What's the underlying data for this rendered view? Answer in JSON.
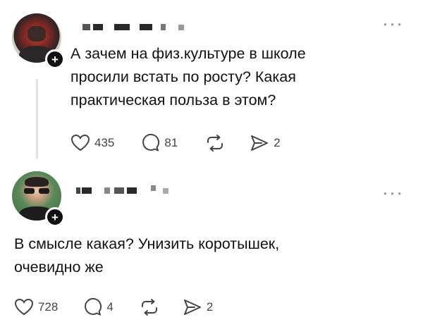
{
  "posts": [
    {
      "username": "",
      "text": "А зачем на физ.культуре в школе просили встать по росту? Какая практическая польза в этом?",
      "likes": "435",
      "comments": "81",
      "shares": "2"
    },
    {
      "username": "",
      "text": "В смысле какая? Унизить коротышек, очевидно же",
      "likes": "728",
      "comments": "4",
      "shares": "2"
    }
  ],
  "icons": {
    "more": "more-horizontal-icon",
    "like": "heart-icon",
    "comment": "comment-bubble-icon",
    "repost": "repost-icon",
    "share": "send-icon",
    "follow": "plus-icon"
  },
  "colors": {
    "text": "#111111",
    "muted": "#444444",
    "divider": "#e2e2e2",
    "badge": "#111111"
  }
}
